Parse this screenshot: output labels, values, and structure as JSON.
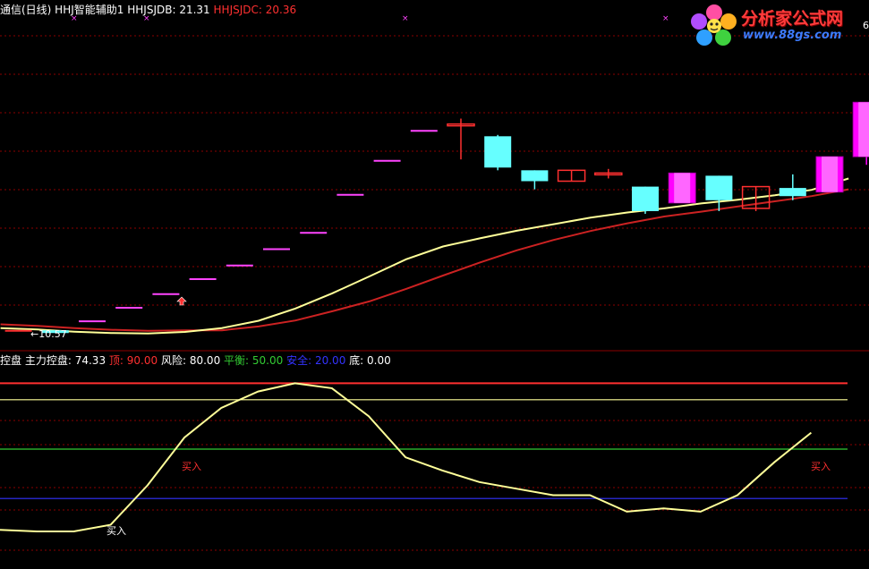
{
  "colors": {
    "background": "#000000",
    "grid": "#8b0000",
    "up_candle": "#ff00ff",
    "down_candle": "#66ffff",
    "doji": "#ff3030",
    "ma_fast": "#ffff99",
    "ma_slow": "#cc2222",
    "step_marks": "#ff44ff",
    "top_line": "#ff3030",
    "risk_line": "#ffff99",
    "balance_line": "#33cc33",
    "safe_line": "#3333ff",
    "control_line": "#ffff99"
  },
  "header_top": {
    "title": "通信(日线) HHJ智能辅助1",
    "jdb_label": "HHJSJDB:",
    "jdb_value": "21.31",
    "jdc_label": "HHJSJDC:",
    "jdc_value": "20.36",
    "axis_fragment": "6"
  },
  "header_bottom": {
    "title": "控盘",
    "zhukong_label": "主力控盘:",
    "zhukong_value": "74.33",
    "ding_label": "顶:",
    "ding_value": "90.00",
    "fengxian_label": "风险:",
    "fengxian_value": "80.00",
    "pingheng_label": "平衡:",
    "pingheng_value": "50.00",
    "anquan_label": "安全:",
    "anquan_value": "20.00",
    "di_label": "底:",
    "di_value": "0.00"
  },
  "logo": {
    "name": "分析家公式网",
    "url": "www.88gs.com"
  },
  "chart_data": [
    {
      "type": "candlestick",
      "price_range": [
        10.2,
        22.2
      ],
      "annotation": "←10.57",
      "candles": [
        {
          "open": 10.7,
          "close": 10.7,
          "high": 10.7,
          "low": 10.7,
          "color": "doji"
        },
        {
          "open": 10.72,
          "close": 10.62,
          "high": 10.72,
          "low": 10.62,
          "color": "down"
        },
        {
          "open": 11.05,
          "close": 11.05,
          "high": 11.05,
          "low": 11.05,
          "color": "up"
        },
        {
          "open": 11.55,
          "close": 11.55,
          "high": 11.55,
          "low": 11.55,
          "color": "up"
        },
        {
          "open": 12.05,
          "close": 12.05,
          "high": 12.05,
          "low": 12.05,
          "color": "up"
        },
        {
          "open": 12.6,
          "close": 12.6,
          "high": 12.6,
          "low": 12.6,
          "color": "up"
        },
        {
          "open": 13.1,
          "close": 13.1,
          "high": 13.1,
          "low": 13.1,
          "color": "up"
        },
        {
          "open": 13.7,
          "close": 13.7,
          "high": 13.7,
          "low": 13.7,
          "color": "up"
        },
        {
          "open": 14.3,
          "close": 14.3,
          "high": 14.3,
          "low": 14.3,
          "color": "up"
        },
        {
          "open": 15.7,
          "close": 15.7,
          "high": 15.7,
          "low": 15.7,
          "color": "up"
        },
        {
          "open": 16.95,
          "close": 16.95,
          "high": 16.95,
          "low": 16.95,
          "color": "up"
        },
        {
          "open": 18.05,
          "close": 18.05,
          "high": 18.05,
          "low": 18.05,
          "color": "up"
        },
        {
          "open": 18.3,
          "close": 18.3,
          "high": 18.5,
          "low": 17.0,
          "color": "doji"
        },
        {
          "open": 17.85,
          "close": 16.7,
          "high": 17.9,
          "low": 16.6,
          "color": "down"
        },
        {
          "open": 16.6,
          "close": 16.2,
          "high": 16.6,
          "low": 15.9,
          "color": "down"
        },
        {
          "open": 16.2,
          "close": 16.6,
          "high": 16.6,
          "low": 16.2,
          "color": "doji"
        },
        {
          "open": 16.5,
          "close": 16.5,
          "high": 16.65,
          "low": 16.3,
          "color": "doji"
        },
        {
          "open": 16.0,
          "close": 15.1,
          "high": 16.0,
          "low": 15.0,
          "color": "down"
        },
        {
          "open": 15.4,
          "close": 16.5,
          "high": 16.5,
          "low": 15.4,
          "color": "up"
        },
        {
          "open": 16.4,
          "close": 15.5,
          "high": 16.4,
          "low": 15.1,
          "color": "down"
        },
        {
          "open": 15.2,
          "close": 16.0,
          "high": 16.0,
          "low": 15.1,
          "color": "doji"
        },
        {
          "open": 15.95,
          "close": 15.65,
          "high": 16.45,
          "low": 15.5,
          "color": "down"
        },
        {
          "open": 15.8,
          "close": 17.1,
          "high": 17.1,
          "low": 15.8,
          "color": "up"
        },
        {
          "open": 17.1,
          "close": 19.1,
          "high": 19.1,
          "low": 16.8,
          "color": "up"
        }
      ],
      "ma_fast": [
        10.8,
        10.75,
        10.67,
        10.62,
        10.6,
        10.66,
        10.8,
        11.07,
        11.52,
        12.08,
        12.7,
        13.33,
        13.8,
        14.1,
        14.38,
        14.62,
        14.86,
        15.05,
        15.2,
        15.38,
        15.52,
        15.68,
        15.88,
        16.3
      ],
      "ma_slow": [
        10.94,
        10.88,
        10.8,
        10.74,
        10.7,
        10.72,
        10.72,
        10.86,
        11.08,
        11.42,
        11.78,
        12.24,
        12.73,
        13.21,
        13.66,
        14.04,
        14.37,
        14.65,
        14.9,
        15.08,
        15.27,
        15.46,
        15.65,
        15.9
      ]
    },
    {
      "type": "line",
      "ylim": [
        0,
        100
      ],
      "series_values": [
        1,
        0,
        0,
        4,
        28,
        57,
        75,
        85,
        90,
        87,
        70,
        45,
        37,
        30,
        26,
        22,
        22,
        12,
        14,
        12,
        22,
        42,
        60
      ],
      "levels": [
        {
          "label": "顶",
          "value": 90
        },
        {
          "label": "风险",
          "value": 80
        },
        {
          "label": "平衡",
          "value": 50
        },
        {
          "label": "安全",
          "value": 20
        }
      ],
      "signals": [
        {
          "label": "买入",
          "index": 4.1
        },
        {
          "label": "买入",
          "index": 2.8
        },
        {
          "label": "买入",
          "index": 21.4
        }
      ]
    }
  ]
}
